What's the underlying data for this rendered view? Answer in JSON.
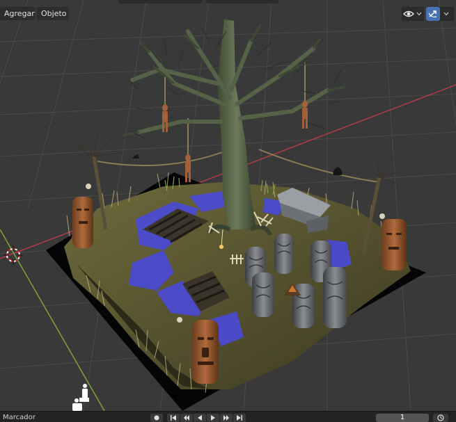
{
  "header": {
    "add_menu": "Agregar",
    "object_menu": "Objeto"
  },
  "overlays": {
    "visibility_icon": "eye-icon",
    "gizmo_icon": "gizmo-icon",
    "gizmo_active": true,
    "accent": "#4772b3"
  },
  "scene": {
    "x_axis_color": "#b23c48",
    "y_axis_color": "#7ea43a",
    "water_color": "#4a4ad8",
    "objects": [
      "dead-tree",
      "hanged-figures",
      "tiki-totems",
      "standing-stones",
      "stone-altar",
      "skeleton",
      "bridges",
      "grass",
      "crow",
      "sun-lamp",
      "3d-cursor",
      "people-silhouette"
    ]
  },
  "timeline": {
    "marker_label": "Marcador",
    "current_frame": "1"
  }
}
